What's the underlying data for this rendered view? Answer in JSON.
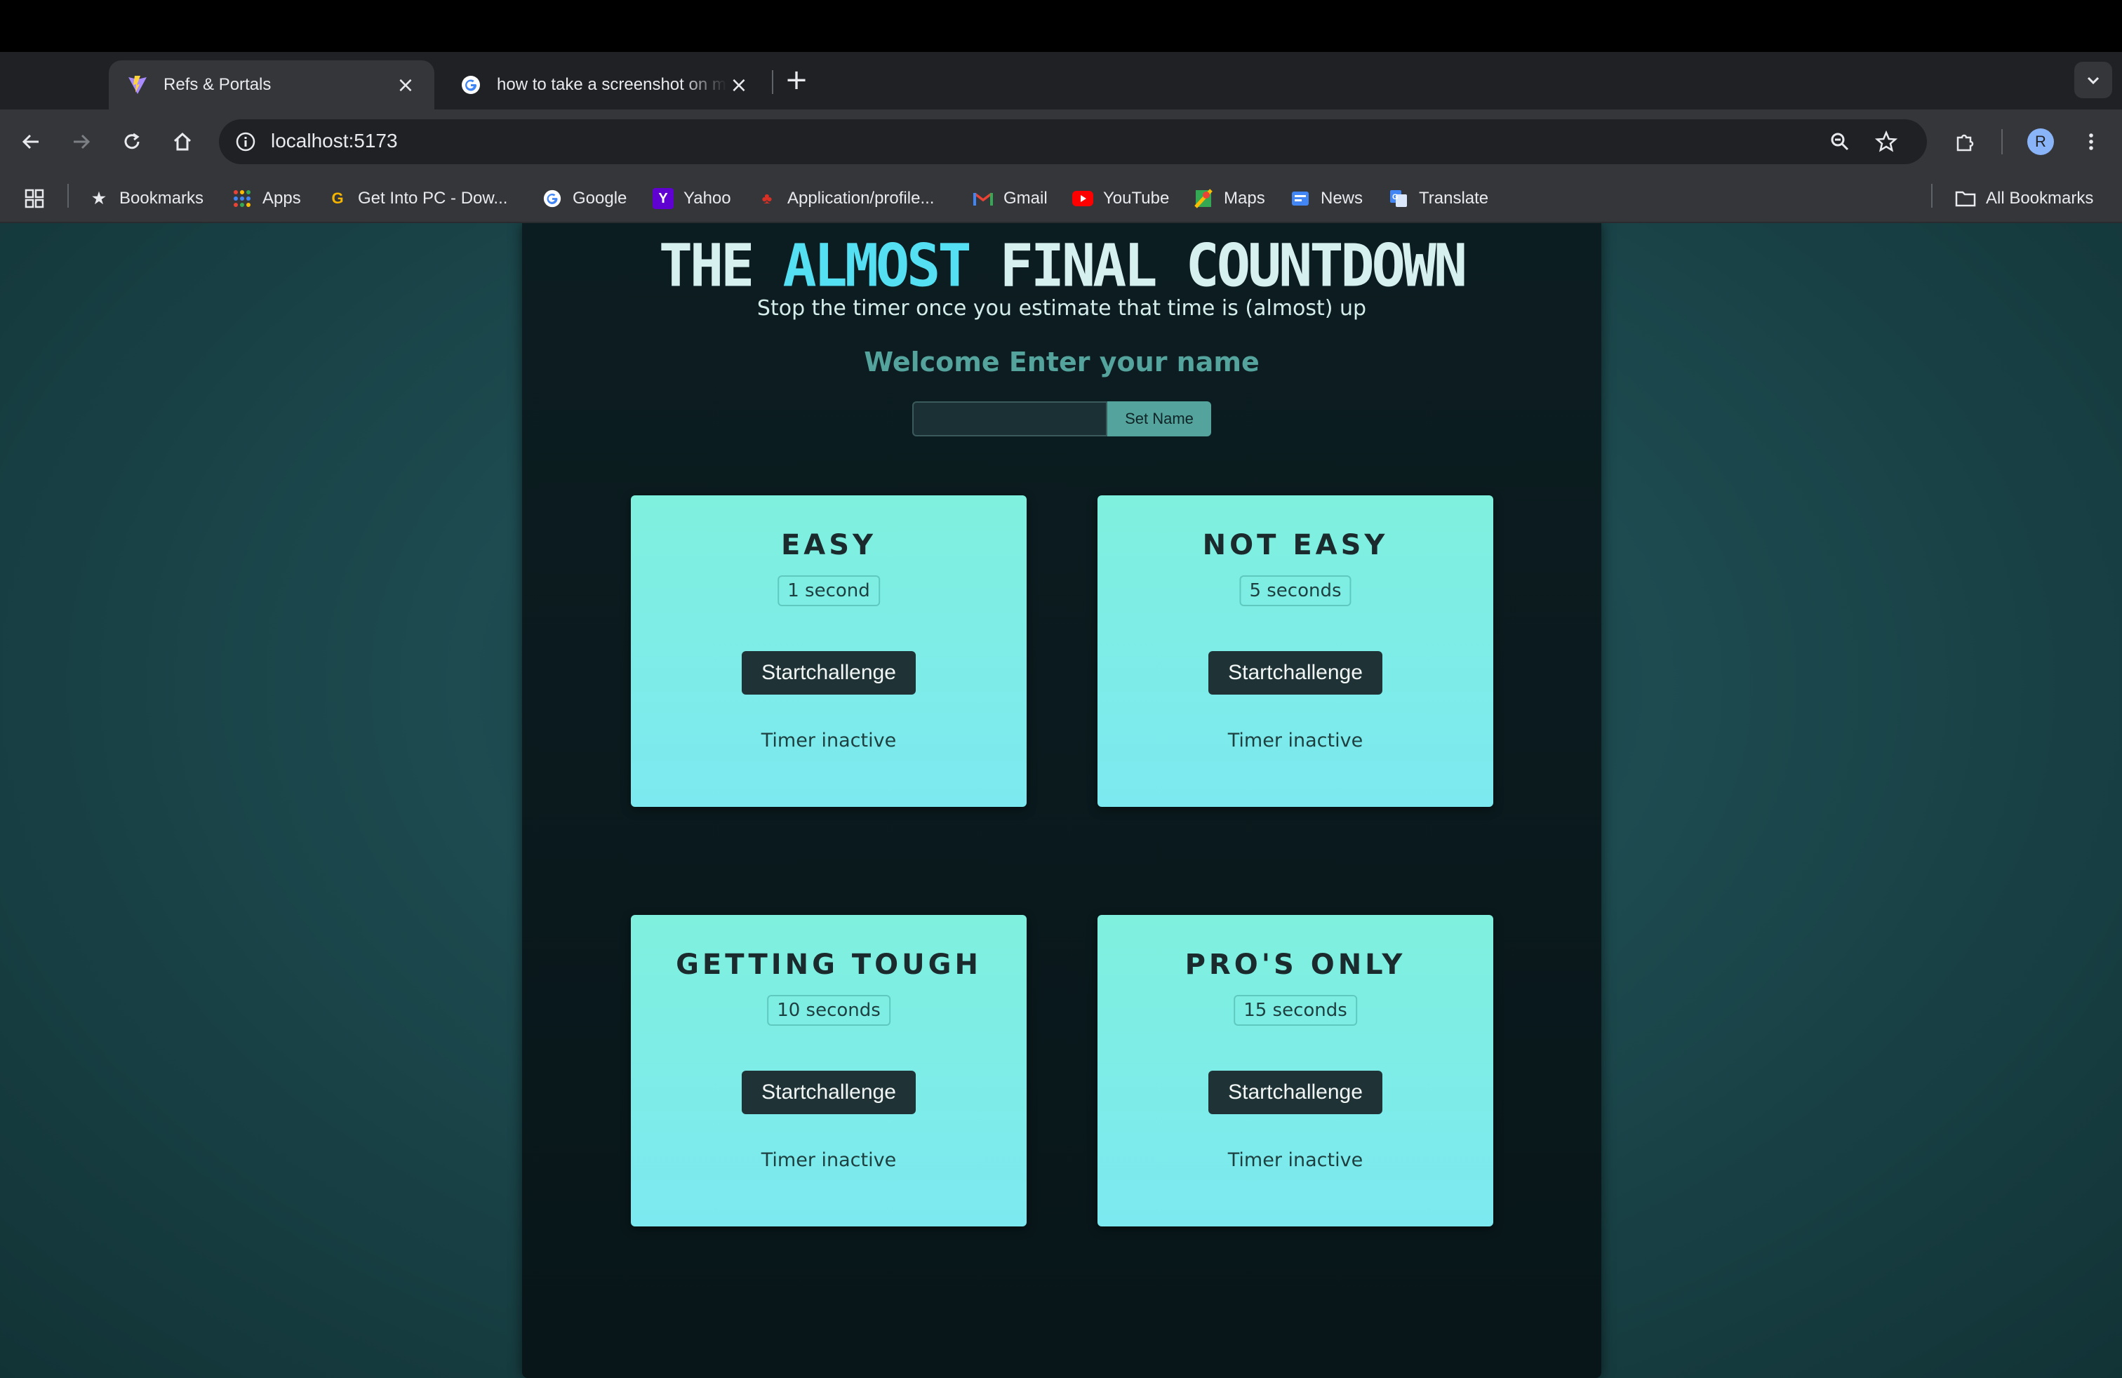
{
  "browser": {
    "tabs": [
      {
        "title": "Refs & Portals",
        "favicon": "vite-icon",
        "active": true
      },
      {
        "title": "how to take a screenshot on mac",
        "favicon": "google-icon",
        "active": false
      }
    ],
    "url": "localhost:5173",
    "profile_initial": "R",
    "bookmarks": [
      {
        "label": "Bookmarks",
        "icon": "star-icon"
      },
      {
        "label": "Apps",
        "icon": "apps-grid-icon"
      },
      {
        "label": "Get Into PC - Dow...",
        "icon": "g-letter-icon"
      },
      {
        "label": "Google",
        "icon": "google-icon"
      },
      {
        "label": "Yahoo",
        "icon": "yahoo-icon"
      },
      {
        "label": "Application/profile...",
        "icon": "maple-leaf-icon"
      },
      {
        "label": "Gmail",
        "icon": "gmail-icon"
      },
      {
        "label": "YouTube",
        "icon": "youtube-icon"
      },
      {
        "label": "Maps",
        "icon": "maps-icon"
      },
      {
        "label": "News",
        "icon": "news-icon"
      },
      {
        "label": "Translate",
        "icon": "translate-icon"
      }
    ],
    "all_bookmarks": "All Bookmarks"
  },
  "page": {
    "title_part1": "THE",
    "title_accent": "ALMOST",
    "title_part2": "FINAL COUNTDOWN",
    "subtitle": "Stop the timer once you estimate that time is (almost) up",
    "welcome": "Welcome Enter your name",
    "name_input_value": "",
    "set_name_label": "Set Name",
    "challenges": [
      {
        "title": "EASY",
        "time": "1 second",
        "button": "Startchallenge",
        "status": "Timer inactive"
      },
      {
        "title": "NOT EASY",
        "time": "5 seconds",
        "button": "Startchallenge",
        "status": "Timer inactive"
      },
      {
        "title": "GETTING TOUGH",
        "time": "10 seconds",
        "button": "Startchallenge",
        "status": "Timer inactive"
      },
      {
        "title": "PRO'S ONLY",
        "time": "15 seconds",
        "button": "Startchallenge",
        "status": "Timer inactive"
      }
    ]
  },
  "colors": {
    "accent": "#54e0f2",
    "card_top": "#7ff0de",
    "card_bottom": "#7ce9f0",
    "button_dark": "#1f3336",
    "welcome_text": "#54a39c"
  }
}
